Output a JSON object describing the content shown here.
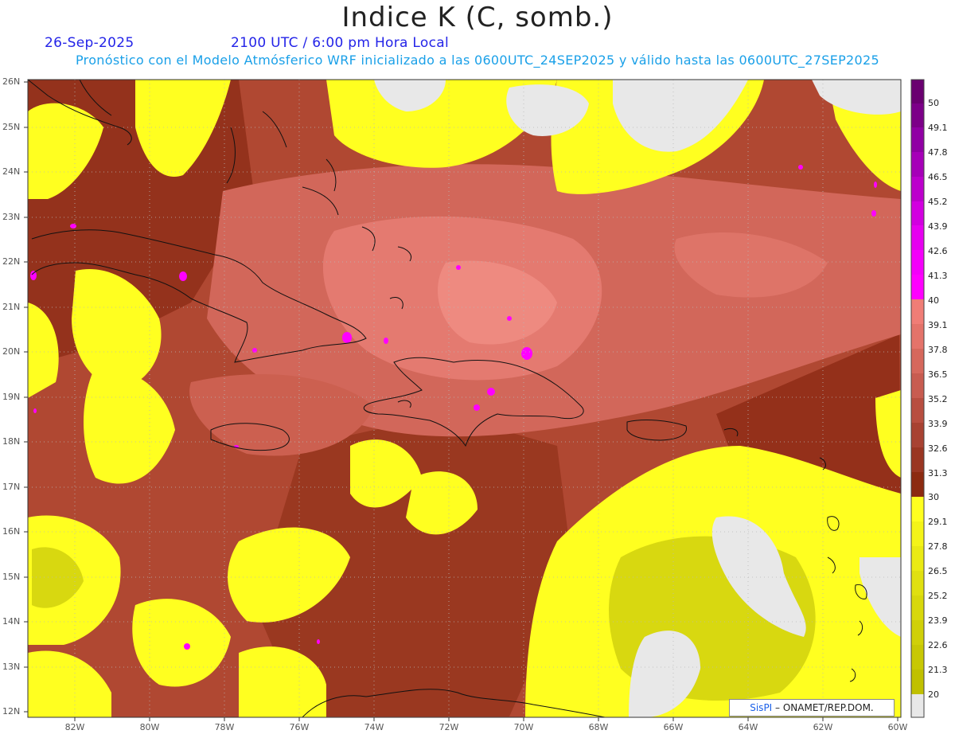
{
  "header": {
    "title": "Indice K (C, somb.)",
    "date": "26-Sep-2025",
    "time": "2100 UTC / 6:00 pm Hora Local",
    "forecast_line": "Pronóstico con el Modelo Atmósferico WRF inicializado a las 0600UTC_24SEP2025 y válido hasta las  0600UTC_27SEP2025"
  },
  "axes": {
    "lat_labels": [
      "26N",
      "25N",
      "24N",
      "23N",
      "22N",
      "21N",
      "20N",
      "19N",
      "18N",
      "17N",
      "16N",
      "15N",
      "14N",
      "13N",
      "12N"
    ],
    "lon_labels": [
      "82W",
      "80W",
      "78W",
      "76W",
      "74W",
      "72W",
      "70W",
      "68W",
      "66W",
      "64W",
      "62W",
      "60W"
    ],
    "lat_range": [
      12,
      26
    ],
    "lon_range": [
      -83.2,
      -60
    ]
  },
  "colorbar": {
    "labels": [
      "50",
      "49.1",
      "47.8",
      "46.5",
      "45.2",
      "43.9",
      "42.6",
      "41.3",
      "40",
      "39.1",
      "37.8",
      "36.5",
      "35.2",
      "33.9",
      "32.6",
      "31.3",
      "30",
      "29.1",
      "27.8",
      "26.5",
      "25.2",
      "23.9",
      "22.6",
      "21.3",
      "20"
    ],
    "colors": {
      "below_20": "#e8e8e8",
      "yellow_low": "#c8c800",
      "yellow_high": "#ffff20",
      "red_low": "#8c2a10",
      "red_high": "#f07d76",
      "magenta_low": "#ff00ff",
      "magenta_high": "#70007a"
    }
  },
  "credit": {
    "brand": "SisPI",
    "text": " – ONAMET/REP.DOM."
  }
}
